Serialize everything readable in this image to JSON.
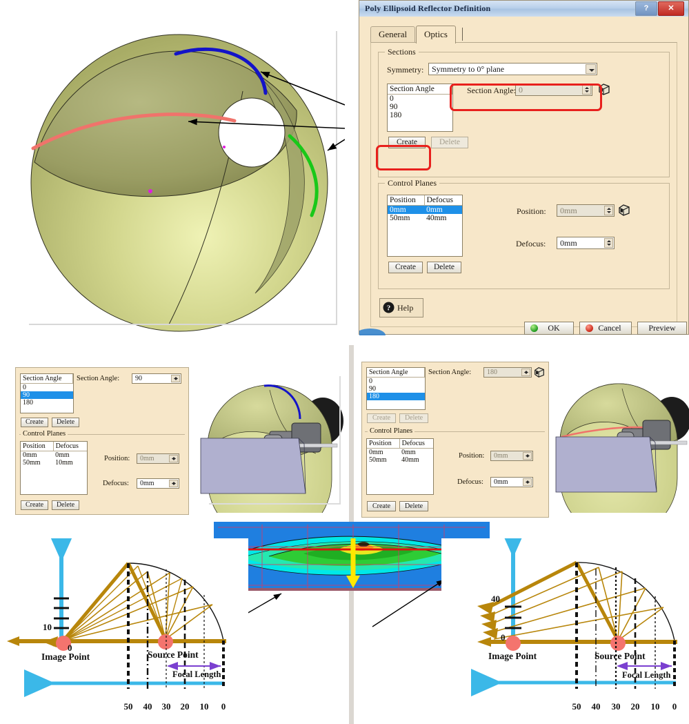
{
  "dialog": {
    "title": "Poly Ellipsoid Reflector Definition",
    "window_buttons": {
      "help": "?",
      "close": "✕"
    },
    "tabs": [
      {
        "label": "General",
        "active": false
      },
      {
        "label": "Optics",
        "active": true
      }
    ],
    "sections_group": {
      "label": "Sections",
      "symmetry_label": "Symmetry:",
      "symmetry_value": "Symmetry to 0° plane",
      "list_header": "Section Angle",
      "list_items": [
        "0",
        "90",
        "180"
      ],
      "selected_index": -1,
      "field_label": "Section Angle:",
      "field_value": "0",
      "create_label": "Create",
      "delete_label": "Delete",
      "picker_icon": "cube-picker-icon"
    },
    "control_planes_group": {
      "label": "Control Planes",
      "columns": [
        "Position",
        "Defocus"
      ],
      "rows": [
        {
          "position": "0mm",
          "defocus": "0mm",
          "selected": true
        },
        {
          "position": "50mm",
          "defocus": "40mm",
          "selected": false
        }
      ],
      "position_label": "Position:",
      "position_value": "0mm",
      "defocus_label": "Defocus:",
      "defocus_value": "0mm",
      "create_label": "Create",
      "delete_label": "Delete",
      "picker_icon": "cube-picker-icon"
    },
    "help_button": "Help",
    "footer_buttons": [
      {
        "label": "OK",
        "icon": "green-orb-icon"
      },
      {
        "label": "Cancel",
        "icon": "red-orb-icon"
      },
      {
        "label": "Preview",
        "icon": ""
      }
    ]
  },
  "panel_left": {
    "list_header": "Section Angle",
    "list_items": [
      "0",
      "90",
      "180"
    ],
    "selected_index": 1,
    "field_label": "Section Angle:",
    "field_value": "90",
    "create_label": "Create",
    "delete_label": "Delete",
    "control_planes_label": "Control Planes",
    "columns": [
      "Position",
      "Defocus"
    ],
    "rows": [
      {
        "position": "0mm",
        "defocus": "0mm"
      },
      {
        "position": "50mm",
        "defocus": "10mm"
      }
    ],
    "position_label": "Position:",
    "position_value": "0mm",
    "defocus_label": "Defocus:",
    "defocus_value": "0mm",
    "cp_create_label": "Create",
    "cp_delete_label": "Delete"
  },
  "panel_right": {
    "list_header": "Section Angle",
    "list_items": [
      "0",
      "90",
      "180"
    ],
    "selected_index": 2,
    "field_label": "Section Angle:",
    "field_value": "180",
    "create_label": "Create",
    "delete_label": "Delete",
    "control_planes_label": "Control Planes",
    "columns": [
      "Position",
      "Defocus"
    ],
    "rows": [
      {
        "position": "0mm",
        "defocus": "0mm"
      },
      {
        "position": "50mm",
        "defocus": "40mm"
      }
    ],
    "position_label": "Position:",
    "position_value": "0mm",
    "defocus_label": "Defocus:",
    "defocus_value": "0mm",
    "cp_create_label": "Create",
    "cp_delete_label": "Delete"
  },
  "diagram_left": {
    "image_point_label": "Image Point",
    "source_point_label": "Source Point",
    "focal_length_label": "Focal Length",
    "x_ticks": [
      "50",
      "40",
      "30",
      "20",
      "10",
      "0"
    ],
    "y_ticks": [
      "10",
      "0"
    ]
  },
  "diagram_right": {
    "image_point_label": "Image Point",
    "source_point_label": "Source Point",
    "focal_length_label": "Focal Length",
    "x_ticks": [
      "50",
      "40",
      "30",
      "20",
      "10",
      "0"
    ],
    "y_ticks": [
      "40",
      "0"
    ]
  },
  "colors": {
    "dialog_bg": "#f7e7c9",
    "title_blue": "#a9c4e2",
    "selection_blue": "#1e90e8",
    "highlight_red": "#e8201c",
    "reflector_olive": "#b9bd72",
    "curve_blue": "#1313c8",
    "curve_red": "#f0736b",
    "curve_green": "#19c819",
    "ray_gold": "#b8860b",
    "axis_cyan": "#3bb8e8",
    "heatmap_bg": "#1f7fe0"
  },
  "chart_data": {
    "type": "heatmap",
    "title": "",
    "xlabel": "",
    "ylabel": "",
    "legend": [],
    "grid": true,
    "annotations": [
      {
        "name": "horizontal-extent-arrow",
        "color": "#e01010",
        "direction": "horizontal"
      },
      {
        "name": "vertical-extent-arrow",
        "color": "#ffe800",
        "direction": "vertical"
      }
    ],
    "levels": [
      "blue",
      "cyan",
      "green",
      "yellow",
      "orange"
    ],
    "values": [
      [
        0,
        0,
        0,
        0,
        0,
        0,
        0,
        0,
        0,
        0,
        0,
        0
      ],
      [
        0,
        0,
        1,
        1,
        1,
        1,
        1,
        1,
        1,
        1,
        0,
        0
      ],
      [
        0,
        1,
        1,
        2,
        2,
        3,
        4,
        3,
        2,
        1,
        1,
        0
      ],
      [
        0,
        1,
        2,
        2,
        3,
        3,
        4,
        3,
        2,
        2,
        1,
        0
      ],
      [
        0,
        0,
        1,
        1,
        2,
        2,
        2,
        2,
        1,
        1,
        0,
        0
      ],
      [
        0,
        0,
        0,
        0,
        1,
        1,
        1,
        1,
        0,
        0,
        0,
        0
      ]
    ]
  }
}
